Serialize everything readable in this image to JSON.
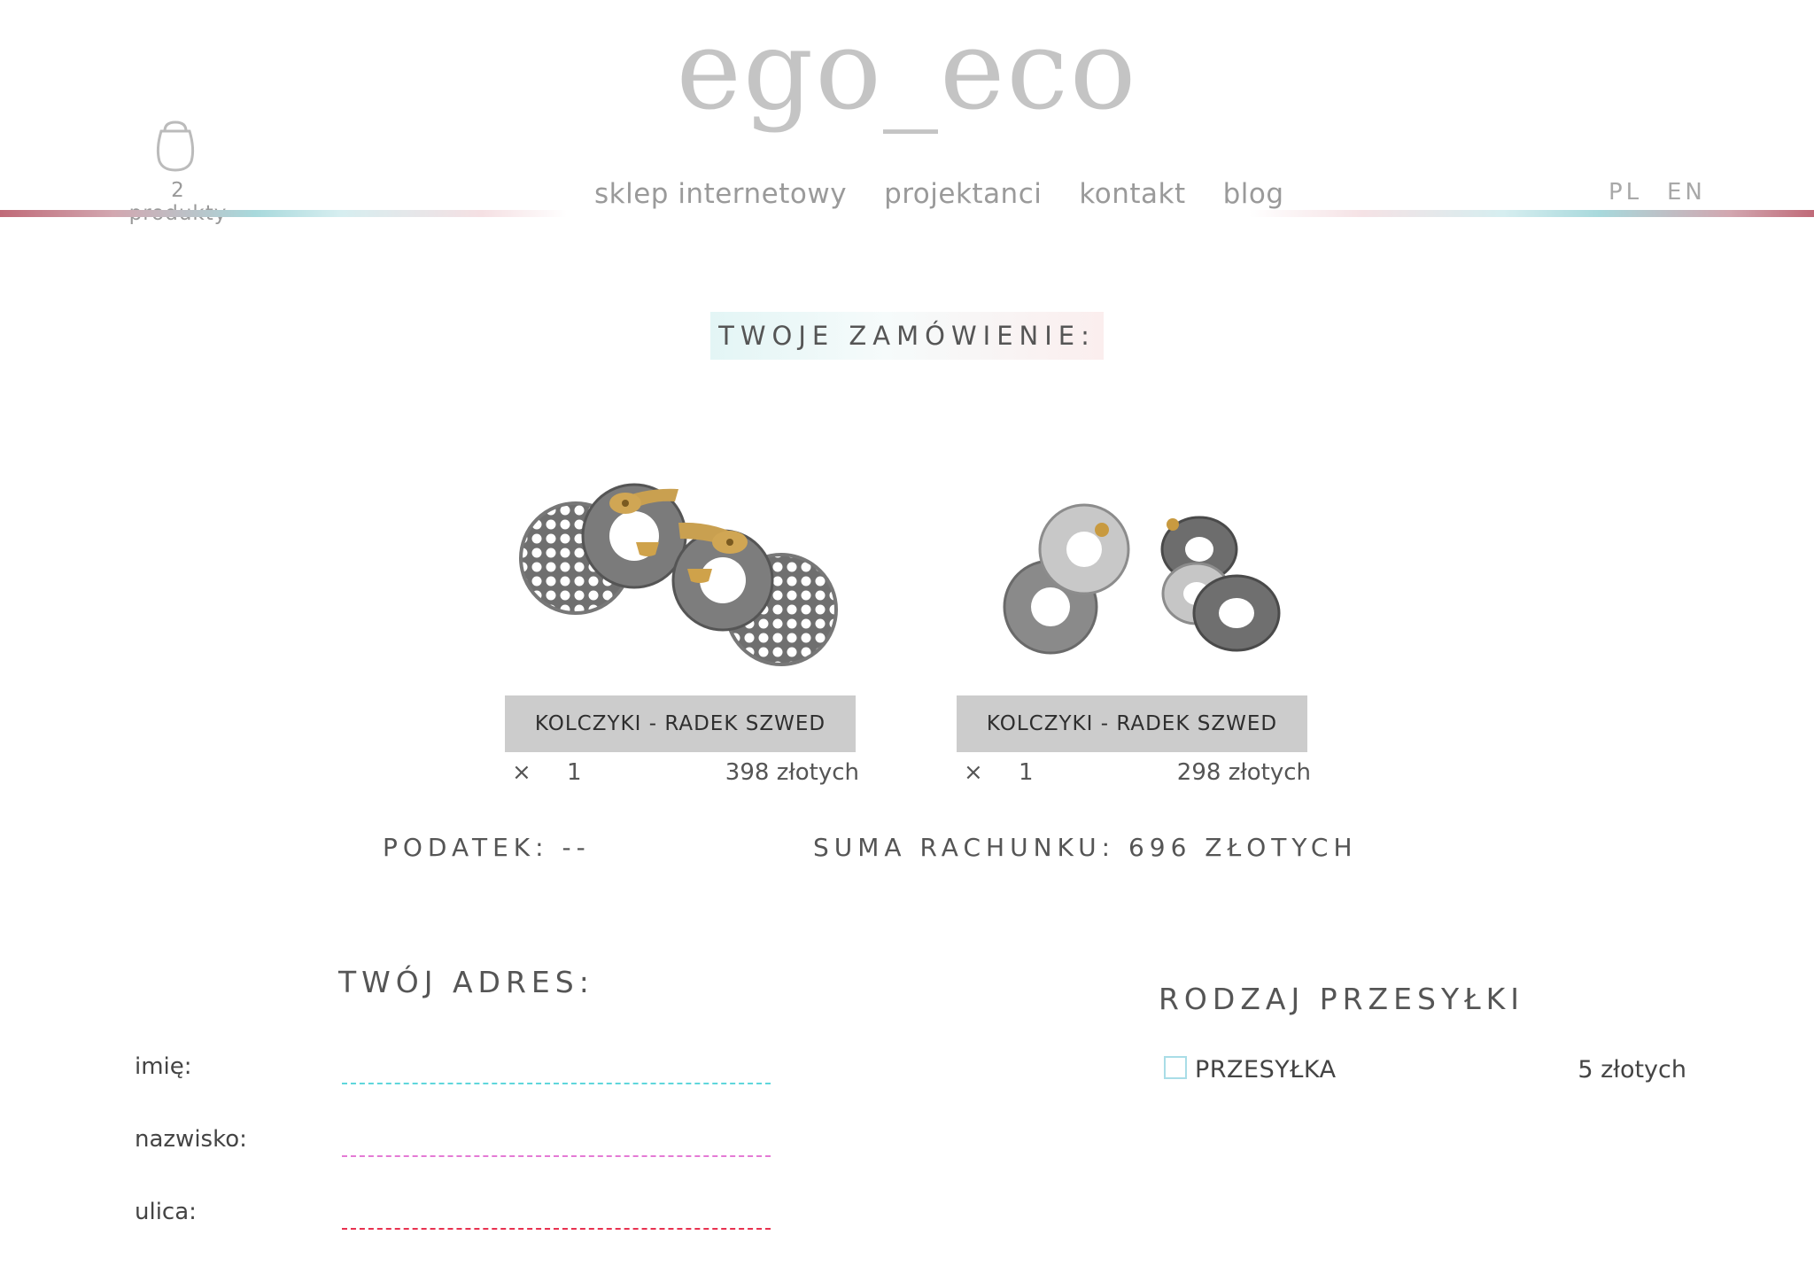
{
  "header": {
    "logo": "ego_eco",
    "cart_count": "2 produkty",
    "nav": [
      "sklep internetowy",
      "projektanci",
      "kontakt",
      "blog"
    ],
    "lang": [
      "PL",
      "EN"
    ]
  },
  "order": {
    "title": "TWOJE ZAMÓWIENIE:",
    "products": [
      {
        "name": "KOLCZYKI - RADEK SZWED",
        "remove": "×",
        "qty": "1",
        "price": "398 złotych"
      },
      {
        "name": "KOLCZYKI - RADEK SZWED",
        "remove": "×",
        "qty": "1",
        "price": "298 złotych"
      }
    ],
    "tax": "PODATEK: --",
    "total": "SUMA RACHUNKU: 696 ZŁOTYCH"
  },
  "address": {
    "title": "TWÓJ ADRES:",
    "fields": [
      {
        "label": "imię:",
        "value": "",
        "color": "#5fd6dc"
      },
      {
        "label": "nazwisko:",
        "value": "",
        "color": "#e47ad5"
      },
      {
        "label": "ulica:",
        "value": "",
        "color": "#e8314f"
      }
    ]
  },
  "shipping": {
    "title": "RODZAJ PRZESYŁKI",
    "option_label": "PRZESYŁKA",
    "option_price": "5 złotych",
    "option_checked": false
  },
  "colors": {
    "accent_pink": "#c06a78",
    "accent_teal": "#a8d9dc",
    "product_label_bg": "#cccccc"
  }
}
